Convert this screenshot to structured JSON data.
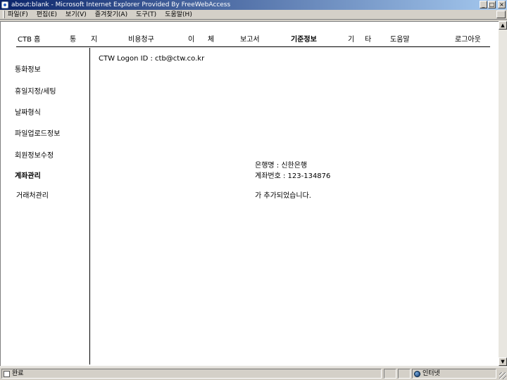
{
  "window": {
    "title": "about:blank - Microsoft Internet Explorer Provided By FreeWebAccess",
    "controls": [
      "_",
      "□",
      "×"
    ]
  },
  "menubar": {
    "items": [
      "파일(F)",
      "편집(E)",
      "보기(V)",
      "즐겨찾기(A)",
      "도구(T)",
      "도움말(H)"
    ]
  },
  "topnav": {
    "home": "CTB 홈",
    "notice_1": "통",
    "notice_2": "지",
    "billing": "비용청구",
    "transfer_1": "이",
    "transfer_2": "체",
    "report": "보고서",
    "basic_info": "기준정보",
    "etc_1": "기",
    "etc_2": "타",
    "help": "도움말",
    "logout": "로그아웃"
  },
  "sidebar": {
    "items": [
      {
        "label": "통화정보"
      },
      {
        "label": "휴일지정/세팅"
      },
      {
        "label": "날짜형식"
      },
      {
        "label": "파일업로드정보"
      },
      {
        "label": "회원정보수정"
      },
      {
        "label": "계좌관리",
        "active": true
      },
      {
        "label": "거래처관리"
      }
    ]
  },
  "main": {
    "logon_label": "CTW Logon ID : ctb@ctw.co.kr",
    "bank_line": "은행명 : 신한은행",
    "account_line": "계좌번호 : 123-134876",
    "added_line": "가 추가되었습니다."
  },
  "statusbar": {
    "status_text": "완료",
    "zone_text": "인터넷"
  },
  "colors": {
    "titlebar_start": "#0a246a",
    "titlebar_end": "#a6caf0",
    "chrome": "#d4d0c8",
    "content_bg": "#ffffff"
  }
}
